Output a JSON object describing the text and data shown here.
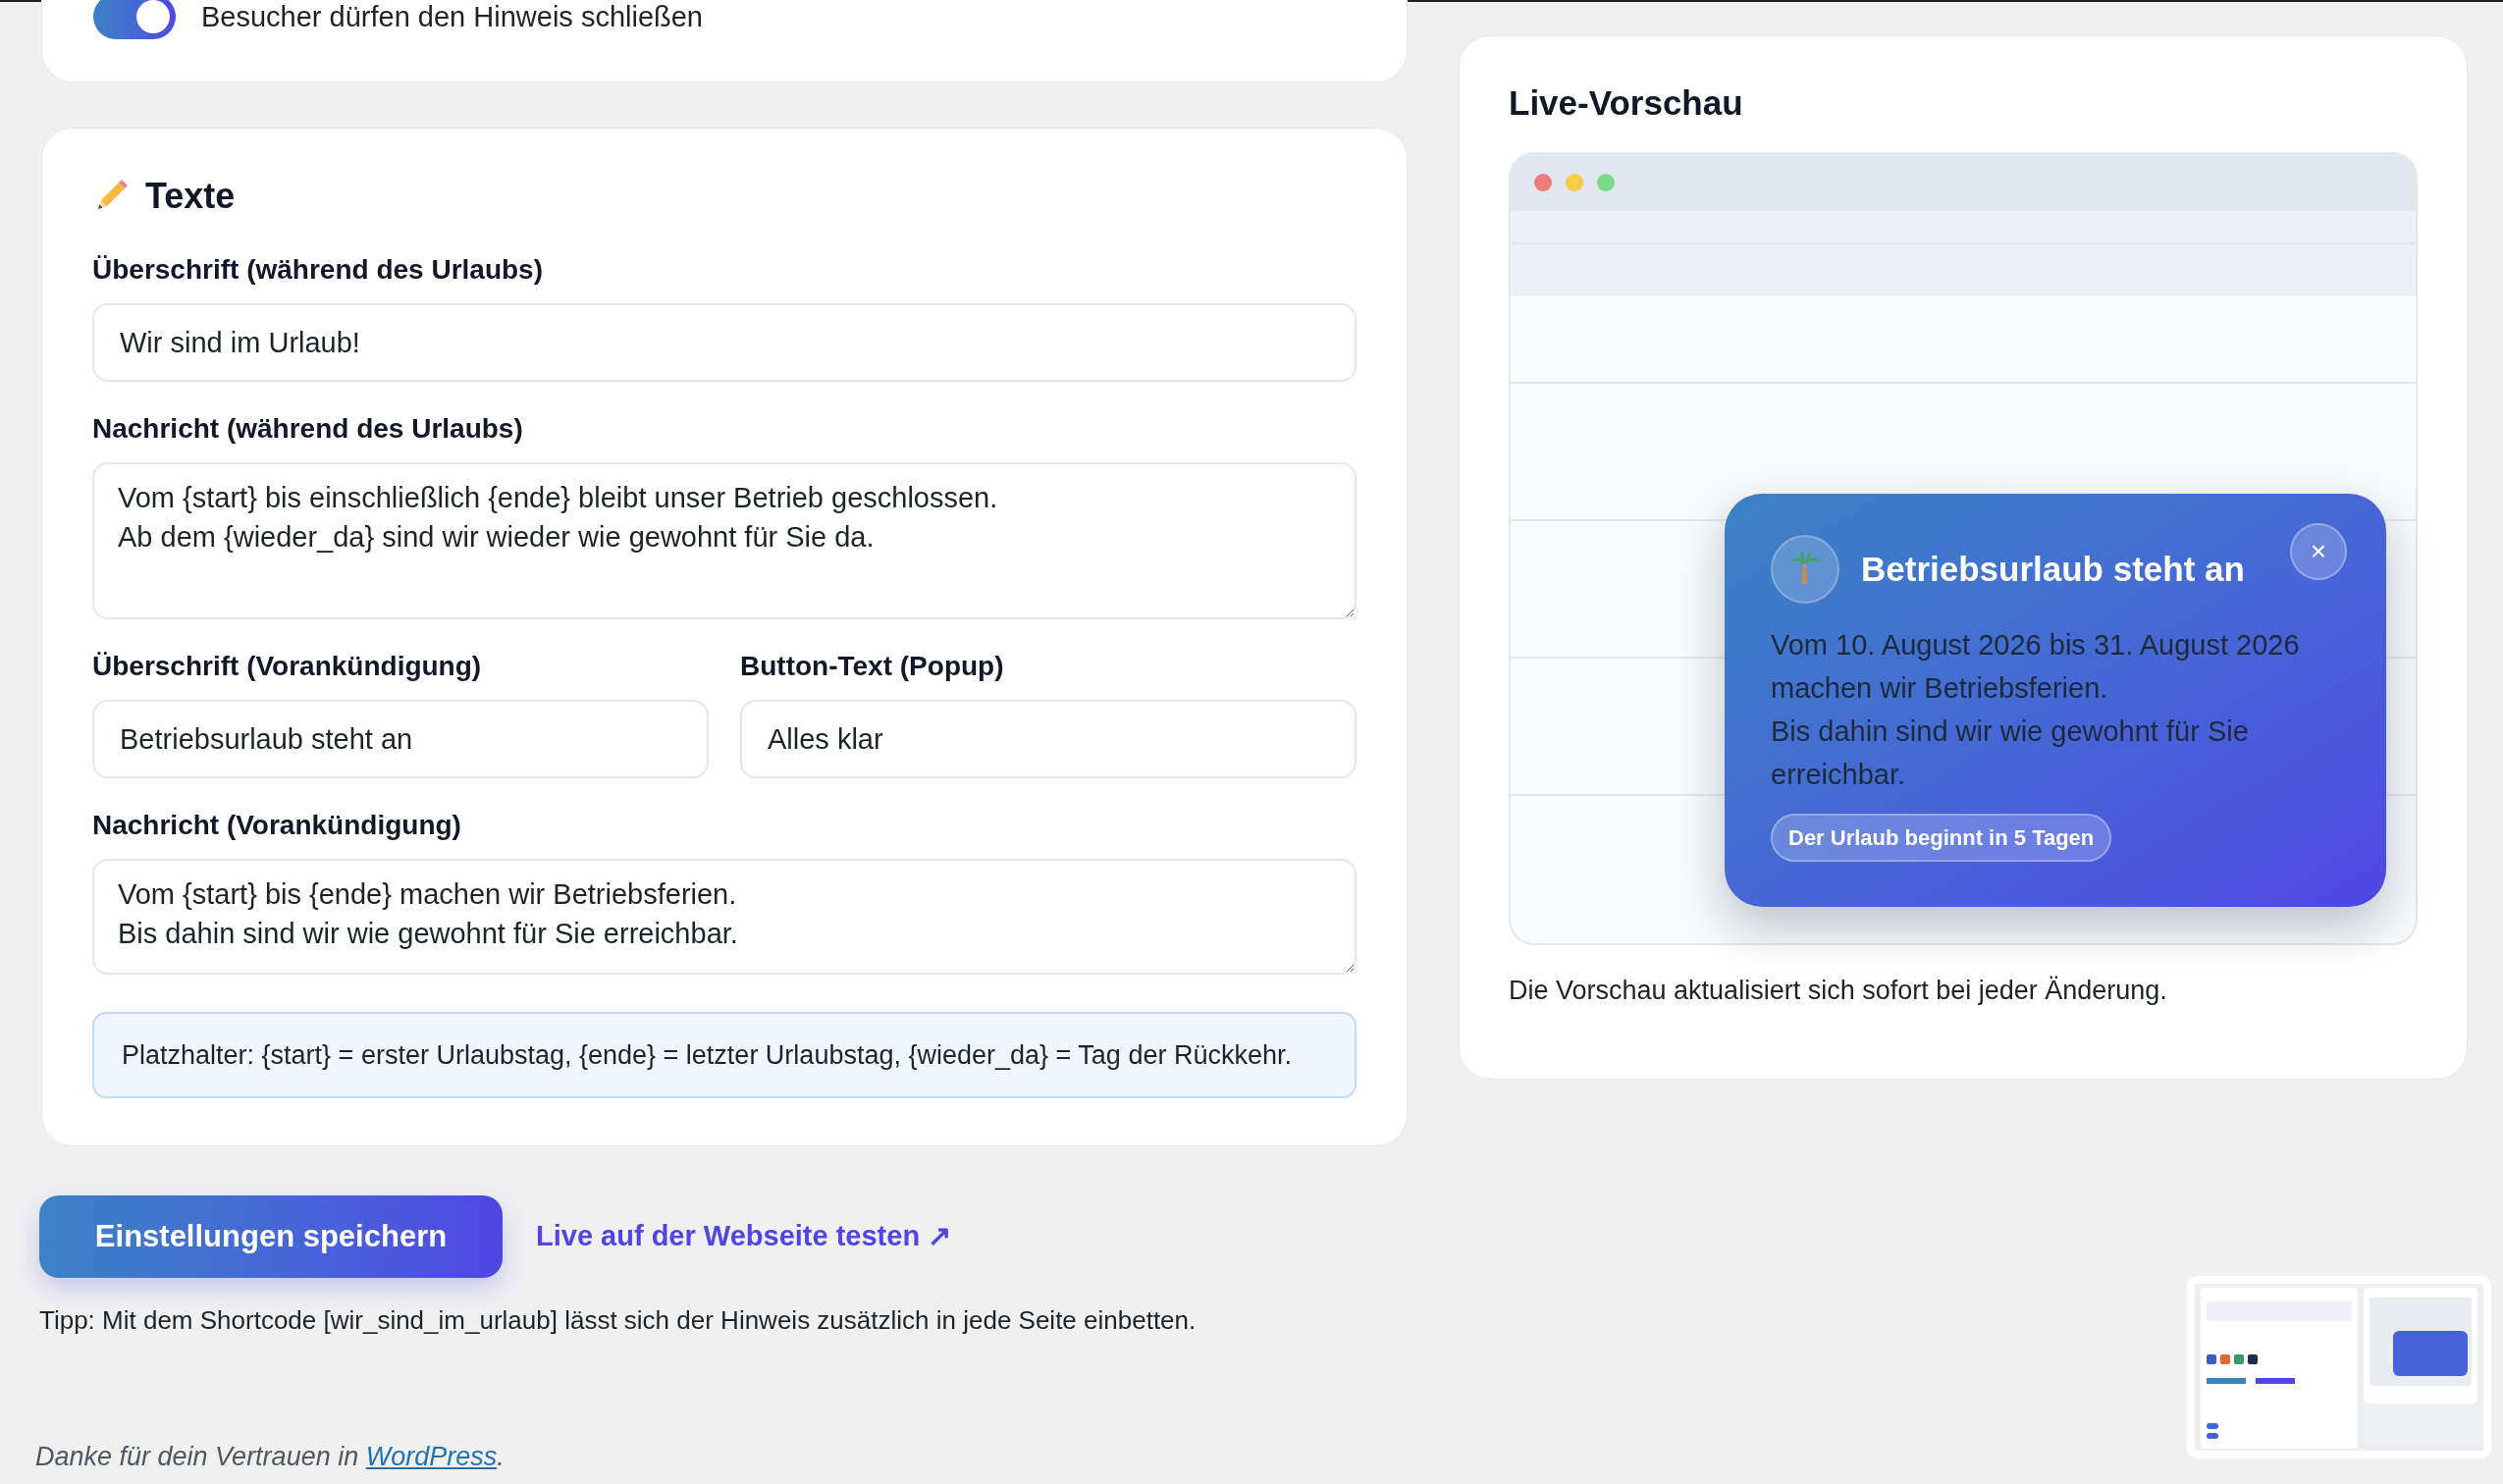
{
  "top_card": {
    "toggle": {
      "label": "Besucher dürfen den Hinweis schließen",
      "on": true
    }
  },
  "texts_card": {
    "title": "Texte",
    "rows": [
      [
        {
          "kind": "input",
          "label": "Überschrift (während des Urlaubs)",
          "value": "Wir sind im Urlaub!"
        }
      ],
      [
        {
          "kind": "textarea",
          "label": "Nachricht (während des Urlaubs)",
          "value": "Vom {start} bis einschließlich {ende} bleibt unser Betrieb geschlossen.\nAb dem {wieder_da} sind wir wieder wie gewohnt für Sie da."
        }
      ],
      [
        {
          "kind": "input",
          "label": "Überschrift (Vorankündigung)",
          "value": "Betriebsurlaub steht an"
        },
        {
          "kind": "input",
          "label": "Button-Text (Popup)",
          "value": "Alles klar"
        }
      ],
      [
        {
          "kind": "textarea",
          "label": "Nachricht (Vorankündigung)",
          "value": "Vom {start} bis {ende} machen wir Betriebsferien.\nBis dahin sind wir wie gewohnt für Sie erreichbar."
        }
      ]
    ],
    "hint": "Platzhalter: {start} = erster Urlaubstag, {ende} = letzter Urlaubstag, {wieder_da} = Tag der Rückkehr."
  },
  "preview": {
    "title": "Live-Vorschau",
    "popup": {
      "title": "Betriebsurlaub steht an",
      "close": "×",
      "message": "Vom 10. August 2026 bis 31. August 2026 machen wir Betriebsferien.\nBis dahin sind wir wie gewohnt für Sie erreichbar.",
      "badge": "Der Urlaub beginnt in 5 Tagen"
    },
    "caption": "Die Vorschau aktualisiert sich sofort bei jeder Änderung."
  },
  "actions": {
    "save_button": "Einstellungen speichern",
    "test_link": "Live auf der Webseite testen ↗"
  },
  "tip": "Tipp: Mit dem Shortcode [wir_sind_im_urlaub] lässt sich der Hinweis zusätzlich in jede Seite einbetten.",
  "footer": {
    "before": "Danke für dein Vertrauen in ",
    "link": "WordPress",
    "after": "."
  }
}
